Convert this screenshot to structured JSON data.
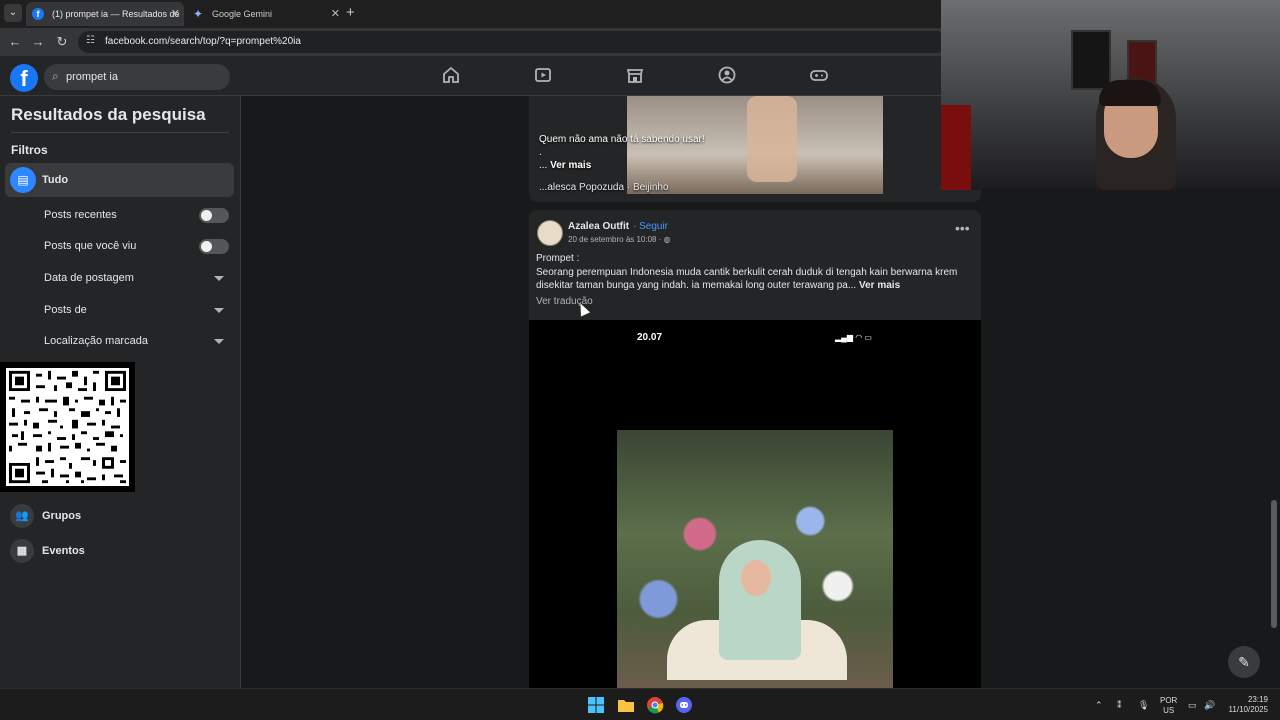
{
  "browser": {
    "tabs": [
      {
        "title": "(1) prompet ia — Resultados de",
        "active": true
      },
      {
        "title": "Google Gemini",
        "active": false
      }
    ],
    "url": "facebook.com/search/top/?q=prompet%20ia"
  },
  "fb": {
    "search_value": "prompet ia"
  },
  "sidebar": {
    "title": "Resultados da pesquisa",
    "filters_label": "Filtros",
    "all_label": "Tudo",
    "items": [
      {
        "label": "Posts recentes",
        "type": "toggle"
      },
      {
        "label": "Posts que você viu",
        "type": "toggle"
      },
      {
        "label": "Data de postagem",
        "type": "dropdown"
      },
      {
        "label": "Posts de",
        "type": "dropdown"
      },
      {
        "label": "Localização marcada",
        "type": "dropdown"
      }
    ],
    "groups_label": "Grupos",
    "events_label": "Eventos"
  },
  "post1": {
    "caption": "Quem não ama não tá sabendo usar!",
    "ellipsis": ".",
    "more_prefix": "... ",
    "more_label": "Ver mais",
    "author": "...alesca Popozuda · Beijinho"
  },
  "post2": {
    "author": "Azalea Outfit",
    "follow": "· Seguir",
    "date": "20 de setembro às 10:08 · ◍",
    "line1": "Prompet :",
    "text": "Seorang perempuan Indonesia muda cantik berkulit cerah duduk di tengah kain berwarna krem disekitar taman bunga yang indah. ia memakai long outer terawang pa...",
    "more_label": "Ver mais",
    "translate": "Ver tradução",
    "phone_time": "20.07",
    "phone_status": "▂▄▆ ◠ ▭"
  },
  "taskbar": {
    "lang1": "POR",
    "lang2": "US",
    "time": "23:19",
    "date": "11/10/2025"
  }
}
